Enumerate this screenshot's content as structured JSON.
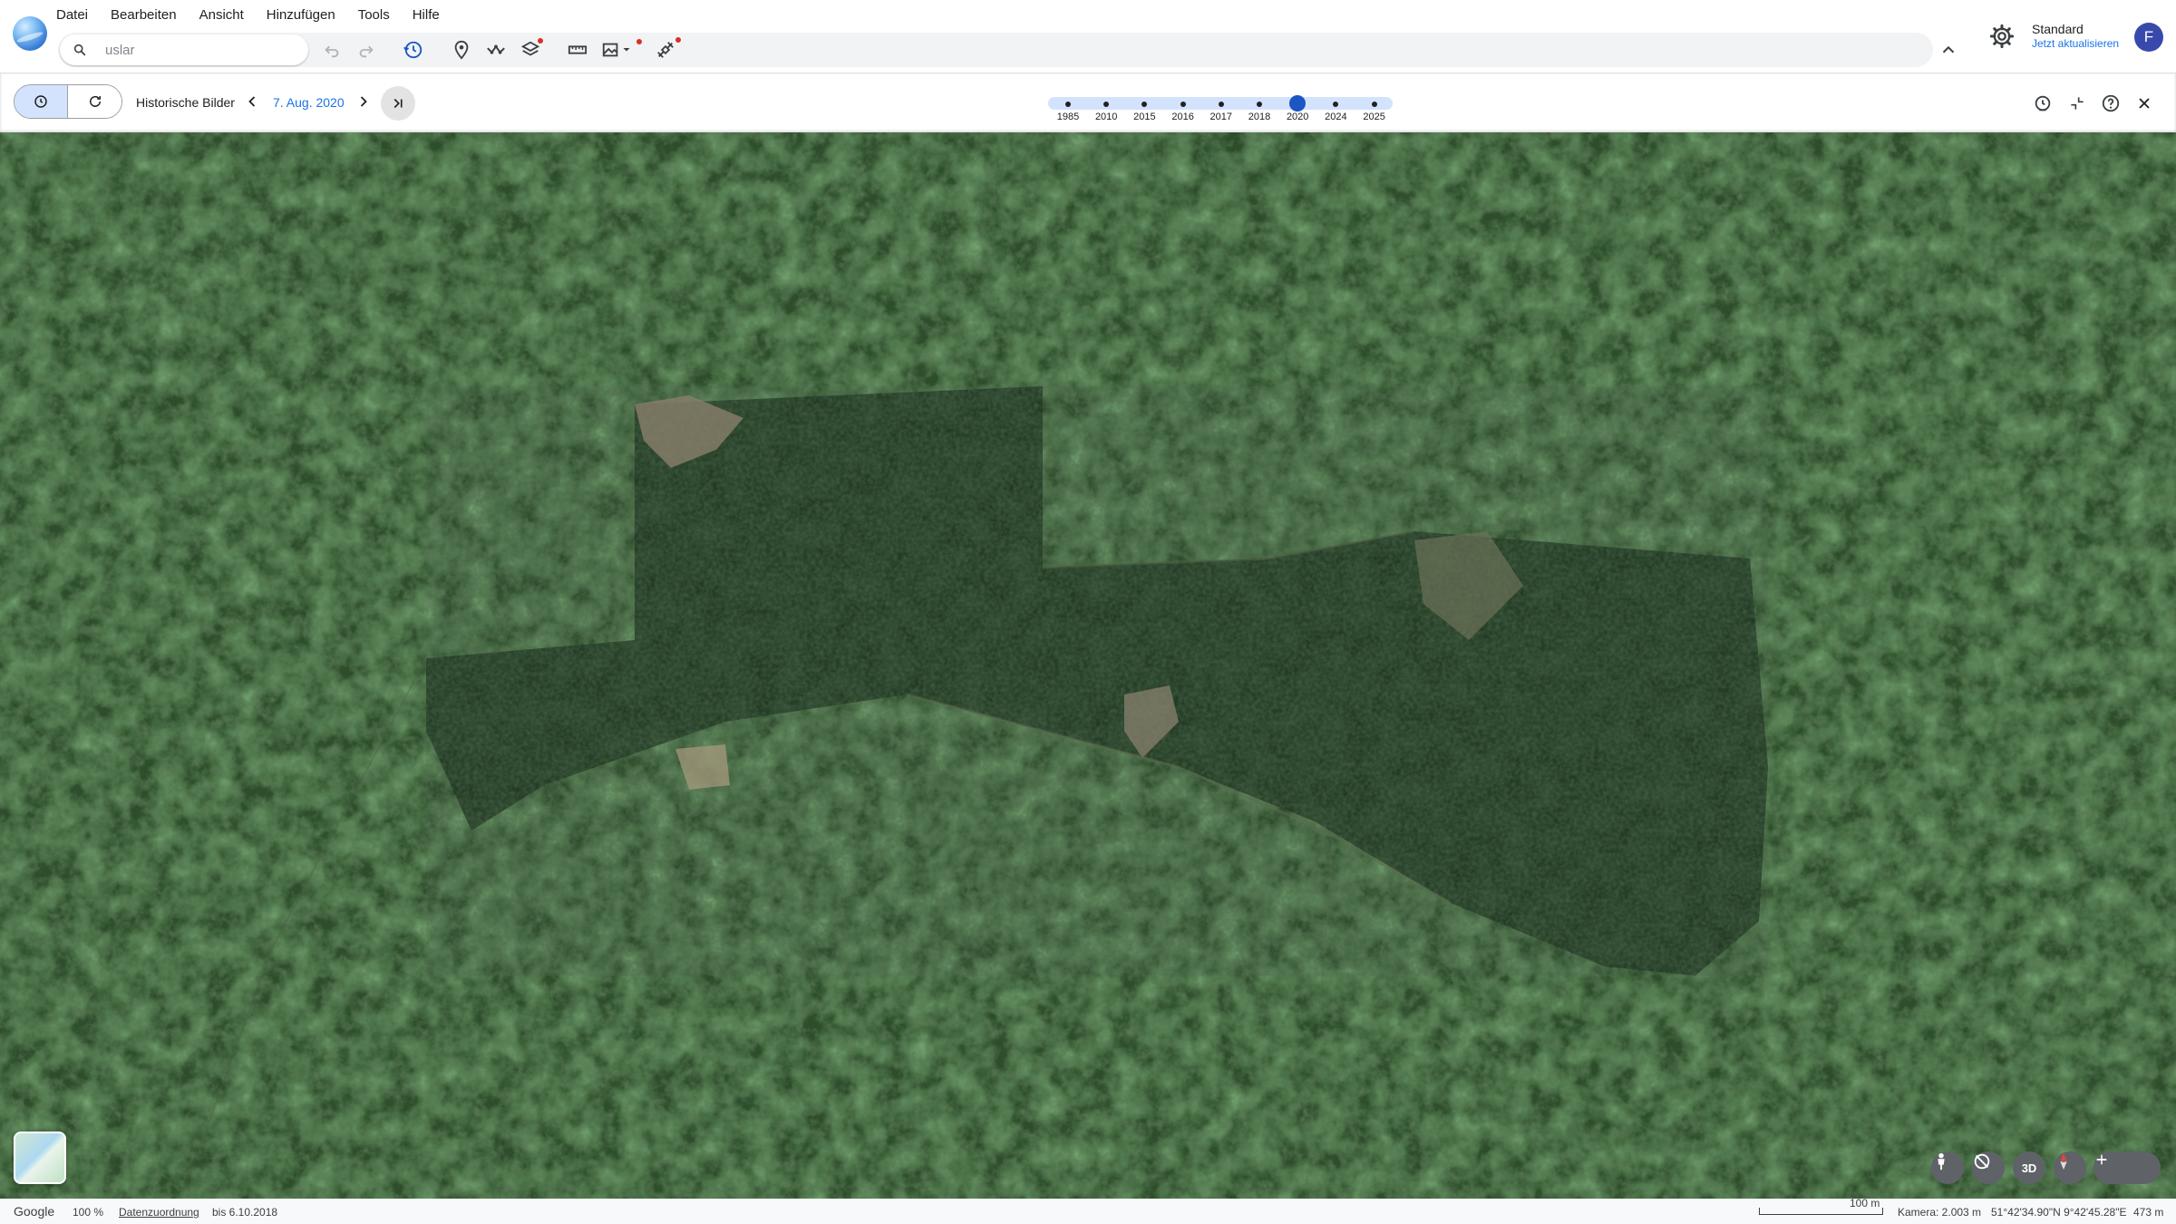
{
  "menu": [
    "Datei",
    "Bearbeiten",
    "Ansicht",
    "Hinzufügen",
    "Tools",
    "Hilfe"
  ],
  "search": {
    "placeholder": "uslar"
  },
  "toolbar": {
    "icons": [
      "undo-icon",
      "redo-icon",
      "history-icon",
      "placemark-icon",
      "path-icon",
      "layers-icon",
      "ruler-icon",
      "image-overlay-icon",
      "satellite-icon"
    ]
  },
  "profile": {
    "name": "Standard",
    "update_link": "Jetzt aktualisieren",
    "initial": "F"
  },
  "history": {
    "label": "Historische Bilder",
    "date": "7. Aug. 2020",
    "years": [
      "1985",
      "2010",
      "2015",
      "2016",
      "2017",
      "2018",
      "2020",
      "2024",
      "2025"
    ],
    "selected_year": "2020"
  },
  "map_controls": {
    "view_3d": "3D"
  },
  "status": {
    "logo": "Google",
    "zoom": "100 %",
    "attribution": "Datenzuordnung",
    "imagery_date": "bis 6.10.2018",
    "scale": "100 m",
    "camera": "Kamera: 2.003 m",
    "coords": "51°42'34.90\"N 9°42'45.28\"E",
    "elevation": "473 m"
  },
  "colors": {
    "accent": "#1a73e8",
    "selected_year": "#1a56c4",
    "timeline_track": "#d3e3fd"
  }
}
